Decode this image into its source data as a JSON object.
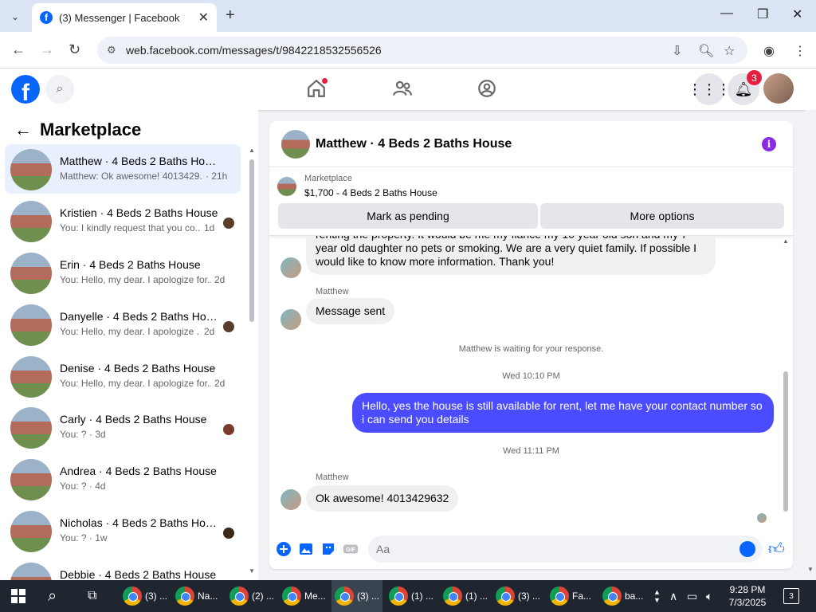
{
  "browser": {
    "tab_title": "(3) Messenger | Facebook",
    "url": "web.facebook.com/messages/t/9842218532556526"
  },
  "fb_header": {
    "notification_count": "3"
  },
  "left_panel": {
    "title": "Marketplace",
    "conversations": [
      {
        "name": "Matthew · 4 Beds 2 Baths House",
        "snippet": "Matthew: Ok awesome! 4013429...",
        "time": "· 21h"
      },
      {
        "name": "Kristien · 4 Beds 2 Baths House",
        "snippet": "You: I kindly request that you co...",
        "time": "1d"
      },
      {
        "name": "Erin · 4 Beds 2 Baths House",
        "snippet": "You: Hello, my dear. I apologize for...",
        "time": "2d"
      },
      {
        "name": "Danyelle · 4 Beds 2 Baths Hou...",
        "snippet": "You: Hello, my dear. I apologize ...",
        "time": "2d"
      },
      {
        "name": "Denise · 4 Beds 2 Baths House",
        "snippet": "You: Hello, my dear. I apologize for...",
        "time": "2d"
      },
      {
        "name": "Carly · 4 Beds 2 Baths House",
        "snippet": "You: ? · 3d",
        "time": ""
      },
      {
        "name": "Andrea · 4 Beds 2 Baths House",
        "snippet": "You: ? · 4d",
        "time": ""
      },
      {
        "name": "Nicholas · 4 Beds 2 Baths Hou...",
        "snippet": "You: ? · 1w",
        "time": ""
      },
      {
        "name": "Debbie · 4 Beds 2 Baths House",
        "snippet": "",
        "time": ""
      }
    ]
  },
  "chat": {
    "title": "Matthew · 4 Beds 2 Baths House",
    "listing_label": "Marketplace",
    "listing_price": "$1,700 - 4 Beds 2 Baths House",
    "mark_pending_label": "Mark as pending",
    "more_options_label": "More options",
    "messages": {
      "partial": "renting the property. It would be me my fiancé my 10 year old son and my 7 year old daughter no pets or smoking. We are a very quiet family. If possible I would like to know more information. Thank you!",
      "sender1": "Matthew",
      "sent_text": "Message sent",
      "waiting": "Matthew is waiting for your response.",
      "time1": "Wed 10:10 PM",
      "mine_text": "Hello, yes the house is still available for rent, let me have your contact number so i can send you  details",
      "time2": "Wed 11:11 PM",
      "sender2": "Matthew",
      "last_text": "Ok awesome! 4013429632"
    },
    "composer_placeholder": "Aa"
  },
  "taskbar": {
    "items": [
      "(3) ...",
      "Na...",
      "(2) ...",
      "Me...",
      "(3) ...",
      "(1) ...",
      "(1) ...",
      "(3) ...",
      "Fa...",
      "ba..."
    ],
    "time": "9:28 PM",
    "date": "7/3/2025",
    "notif_count": "3"
  }
}
